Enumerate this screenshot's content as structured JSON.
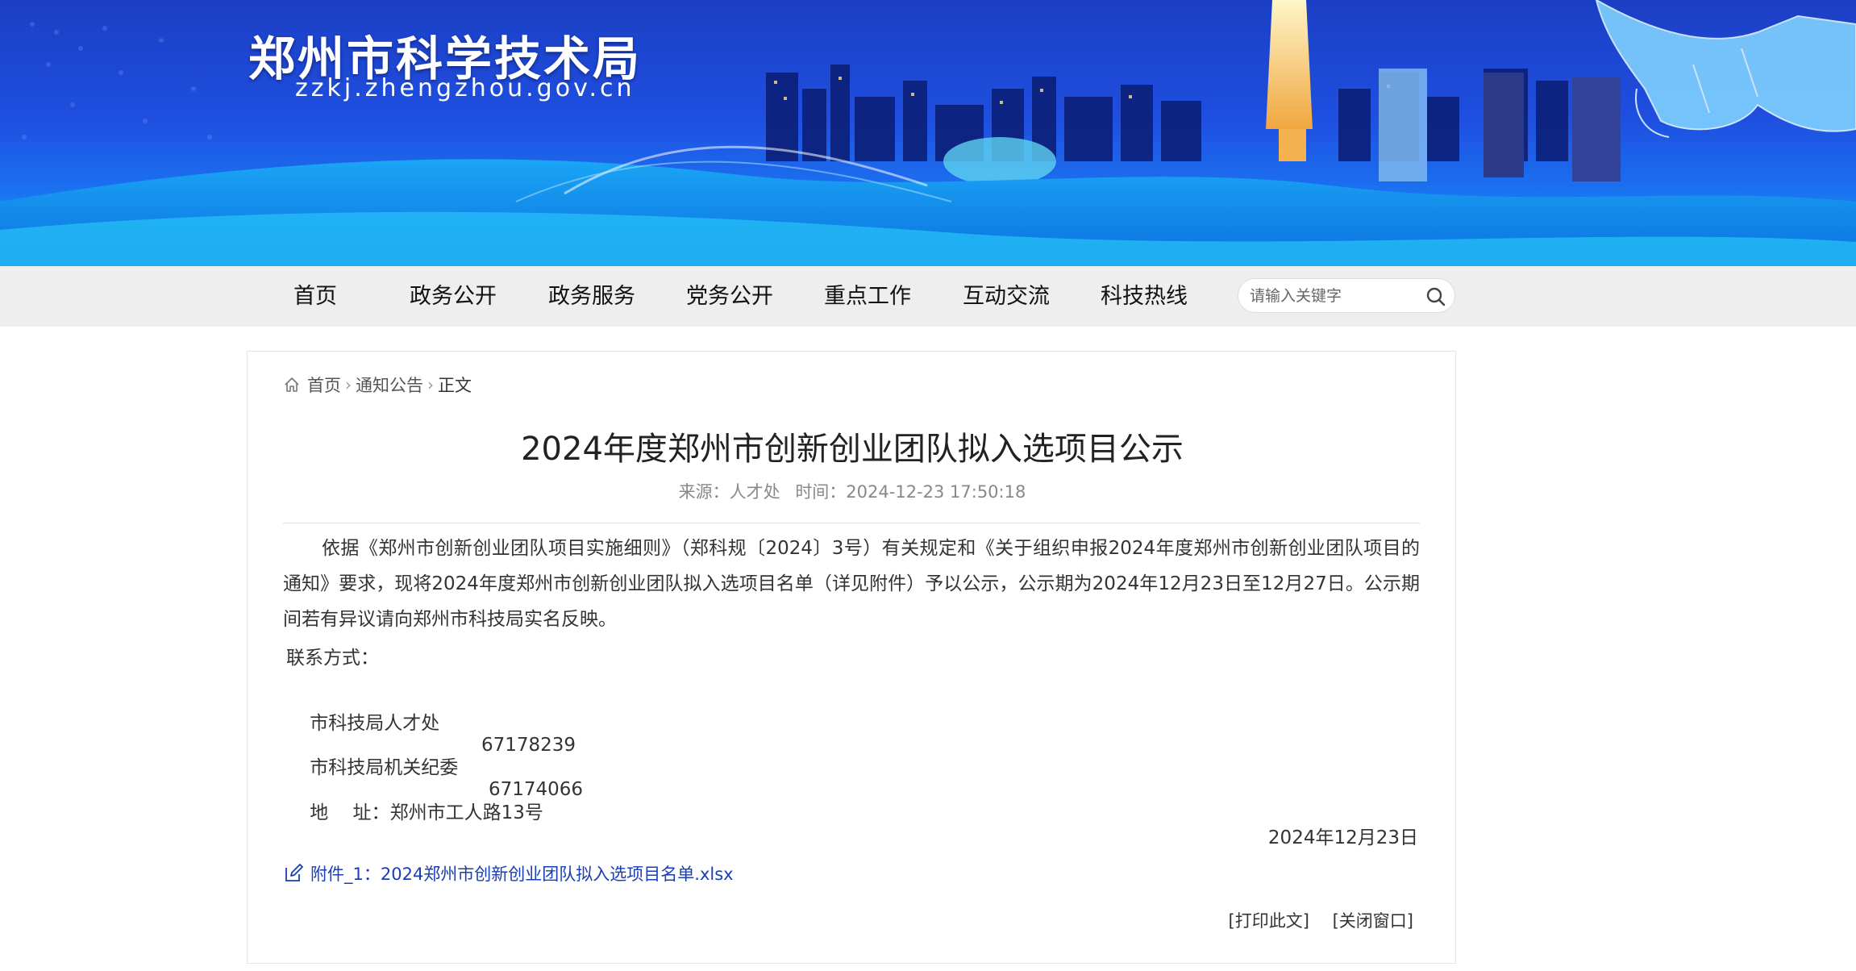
{
  "site": {
    "title": "郑州市科学技术局",
    "domain": "zzkj.zhengzhou.gov.cn"
  },
  "nav": {
    "items": [
      "首页",
      "政务公开",
      "政务服务",
      "党务公开",
      "重点工作",
      "互动交流",
      "科技热线"
    ],
    "search_placeholder": "请输入关键字"
  },
  "breadcrumb": {
    "home": "首页",
    "section": "通知公告",
    "current": "正文"
  },
  "article": {
    "title": "2024年度郑州市创新创业团队拟入选项目公示",
    "source": "来源：人才处",
    "time": "时间：2024-12-23 17:50:18",
    "paragraph": "依据《郑州市创新创业团队项目实施细则》（郑科规〔2024〕3号）有关规定和《关于组织申报2024年度郑州市创新创业团队项目的通知》要求，现将2024年度郑州市创新创业团队拟入选项目名单（详见附件）予以公示，公示期为2024年12月23日至12月27日。公示期间若有异议请向郑州市科技局实名反映。",
    "contact_heading": "联系方式：",
    "contacts": [
      {
        "label": "市科技局人才处",
        "value": "67178239"
      },
      {
        "label": "市科技局机关纪委",
        "value": "67174066"
      }
    ],
    "address_label": "地　 址：",
    "address_value": "郑州市工人路13号",
    "date": "2024年12月23日",
    "attachment": "附件_1：2024郑州市创新创业团队拟入选项目名单.xlsx"
  },
  "actions": {
    "print": "[打印此文]",
    "close": "[关闭窗口]"
  },
  "colors": {
    "banner_blue": "#1f4fe0",
    "nav_bg": "#eeeeee",
    "link_blue": "#1a3eb3"
  }
}
